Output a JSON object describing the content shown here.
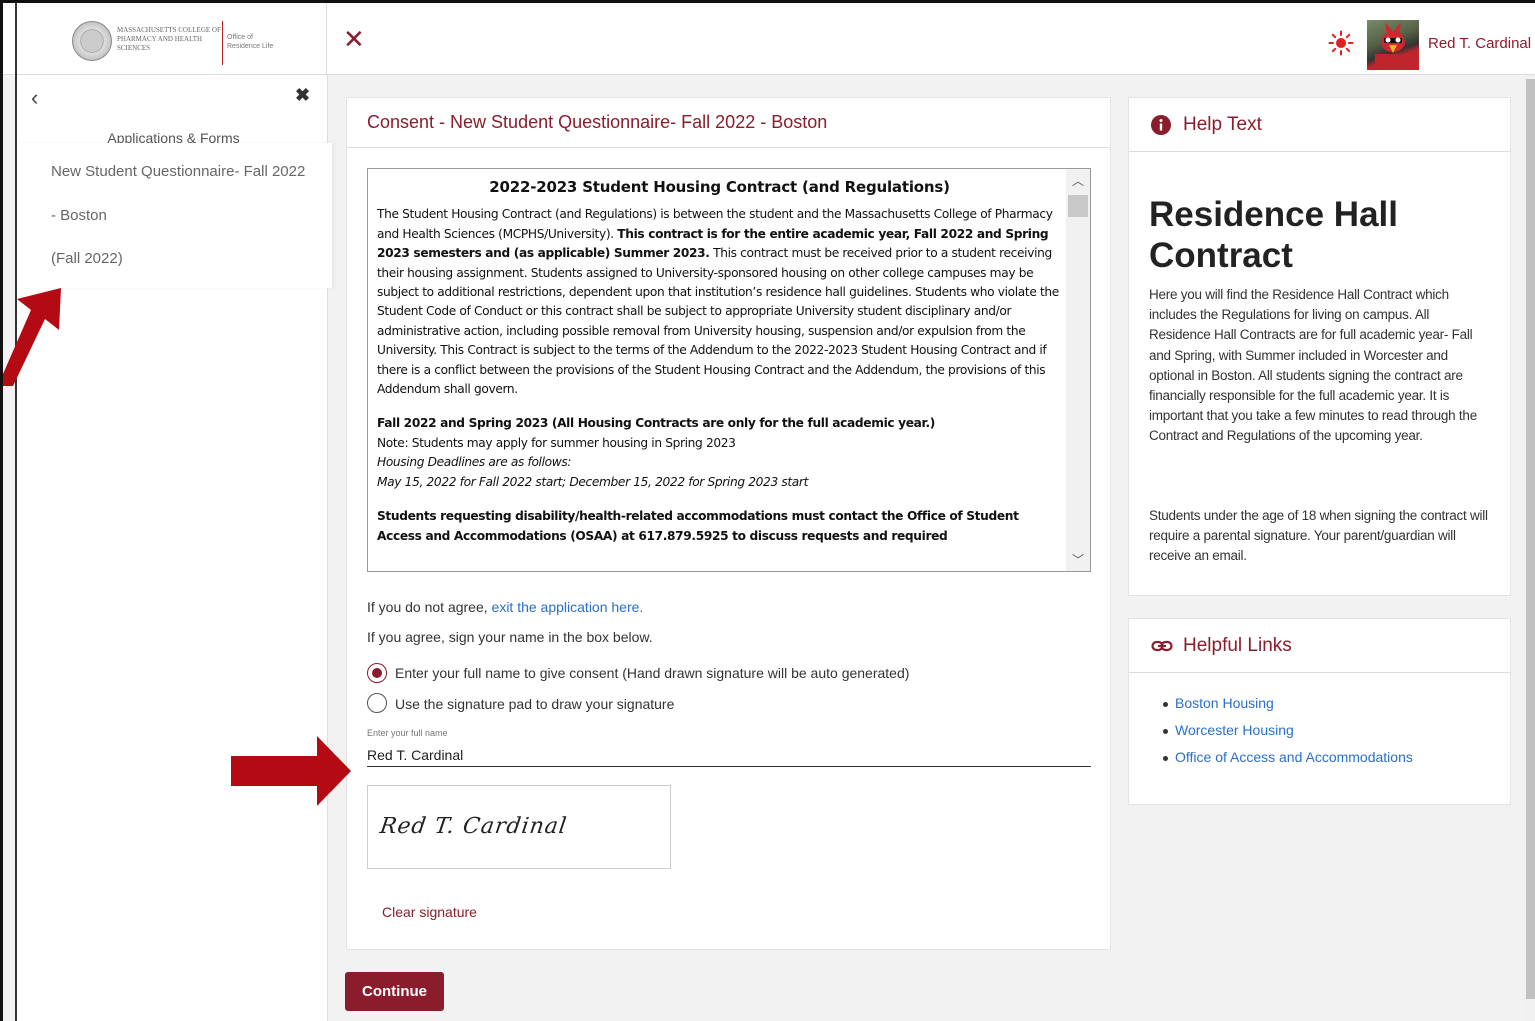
{
  "header": {
    "logo_college": "Massachusetts College of Pharmacy and Health Sciences",
    "logo_office": "Office of Residence Life",
    "user_name": "Red T. Cardinal"
  },
  "sidebar": {
    "heading": "Applications & Forms",
    "item_lines": [
      "New Student Questionnaire- Fall 2022",
      "- Boston",
      "(Fall 2022)"
    ]
  },
  "main": {
    "title": "Consent - New Student Questionnaire- Fall 2022 - Boston",
    "contract": {
      "heading": "2022-2023 Student Housing Contract (and Regulations)",
      "para1_a": "The Student Housing Contract (and Regulations) is between the student and the Massachusetts College of Pharmacy and Health Sciences (MCPHS/University). ",
      "para1_bold": "This contract is for the entire academic year, Fall 2022 and Spring 2023 semesters and (as applicable) Summer 2023.",
      "para1_b": " This contract must be received prior to a student receiving their housing assignment. Students assigned to University-sponsored housing on other college campuses may be subject to additional restrictions, dependent upon that institution’s residence hall guidelines. Students who violate the Student Code of Conduct or this contract shall be subject to appropriate University student disciplinary and/or administrative action, including possible removal from University housing, suspension and/or expulsion from the University. This Contract is subject to the terms of the Addendum to the 2022-2023 Student Housing Contract and if there is a conflict between the provisions of the Student Housing Contract and the Addendum, the provisions of this Addendum shall govern.",
      "para2_bold": "Fall 2022 and Spring 2023 (All Housing Contracts are only for the full academic year.)",
      "para2_note": "Note: Students may apply for summer housing in Spring 2023",
      "para2_deadlines_label": "Housing Deadlines are as follows:",
      "para2_deadlines": "May 15, 2022 for Fall 2022 start; December 15, 2022 for Spring 2023 start",
      "para3_bold": "Students requesting disability/health-related accommodations must contact the Office of Student Access and Accommodations (OSAA) at 617.879.5925 to discuss requests and required"
    },
    "disagree_text": "If you do not agree, ",
    "disagree_link": "exit the application here.",
    "agree_text": "If you agree, sign your name in the box below.",
    "radio_name_label": "Enter your full name to give consent (Hand drawn signature will be auto generated)",
    "radio_pad_label": "Use the signature pad to draw your signature",
    "name_field_label": "Enter your full name",
    "name_field_value": "Red T. Cardinal",
    "signature_text": "Red T. Cardinal",
    "clear_signature": "Clear signature",
    "continue_label": "Continue"
  },
  "help": {
    "title": "Help Text",
    "big_heading": "Residence Hall Contract",
    "para1": "Here you will find the Residence Hall Contract which includes the Regulations for living on campus. All Residence Hall Contracts are for full academic year- Fall and Spring, with Summer included in Worcester and optional in Boston. All students signing the contract are financially responsible for the full academic year. It is important that you take a few minutes to read through the Contract and Regulations of the upcoming year.",
    "para2": "Students under the age of 18 when signing the contract will require a parental signature. Your parent/guardian will receive an email."
  },
  "links": {
    "title": "Helpful Links",
    "items": [
      "Boston Housing",
      "Worcester Housing",
      "Office of Access and Accommodations"
    ]
  },
  "colors": {
    "brand": "#8b1c2b",
    "link": "#2a6fc9",
    "arrow": "#b40a14"
  }
}
